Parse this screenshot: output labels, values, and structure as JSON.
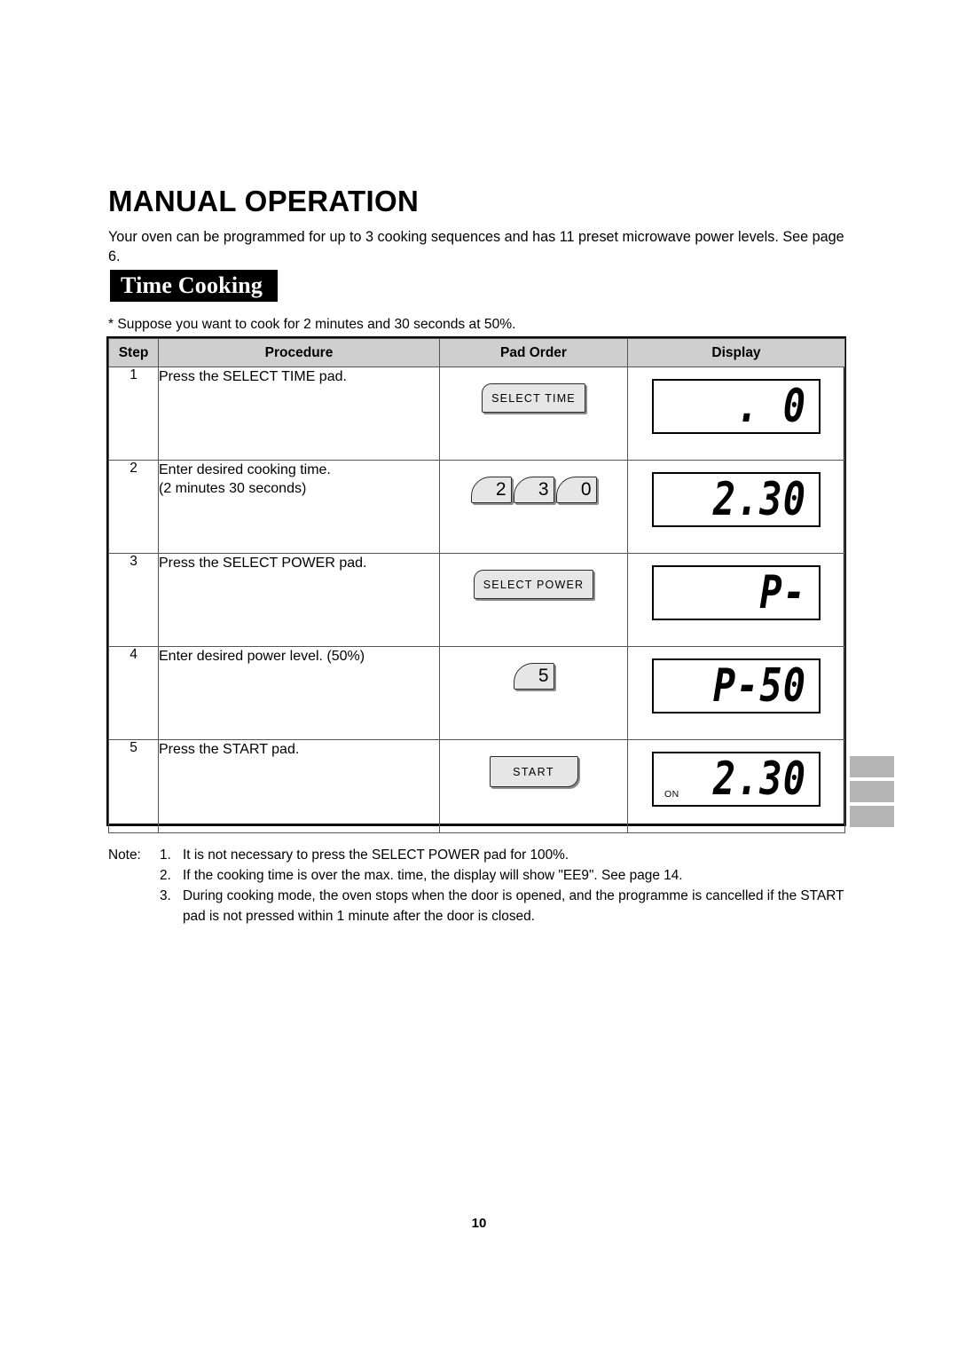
{
  "document": {
    "title": "MANUAL OPERATION",
    "intro": "Your oven can be programmed for up to 3 cooking sequences and has 11 preset microwave power levels. See page 6.",
    "section_banner": "Time Cooking",
    "example_line": "* Suppose you want to cook for 2 minutes and 30 seconds at 50%.",
    "page_number": "10"
  },
  "table": {
    "headers": {
      "step": "Step",
      "procedure": "Procedure",
      "pad_order": "Pad Order",
      "display": "Display"
    },
    "rows": [
      {
        "step": "1",
        "procedure_line1": "Press the SELECT TIME pad.",
        "procedure_line2": "",
        "pads": [
          "SELECT TIME"
        ],
        "pad_type": "text",
        "display": ". 0",
        "display_on": ""
      },
      {
        "step": "2",
        "procedure_line1": "Enter desired cooking time.",
        "procedure_line2": "(2 minutes 30 seconds)",
        "pads": [
          "2",
          "3",
          "0"
        ],
        "pad_type": "number",
        "display": "2.30",
        "display_on": ""
      },
      {
        "step": "3",
        "procedure_line1": "Press the SELECT POWER pad.",
        "procedure_line2": "",
        "pads": [
          "SELECT POWER"
        ],
        "pad_type": "text",
        "display": "P-",
        "display_on": ""
      },
      {
        "step": "4",
        "procedure_line1": "Enter desired power level. (50%)",
        "procedure_line2": "",
        "pads": [
          "5"
        ],
        "pad_type": "number",
        "display": "P-50",
        "display_on": ""
      },
      {
        "step": "5",
        "procedure_line1": "Press the START pad.",
        "procedure_line2": "",
        "pads": [
          "START"
        ],
        "pad_type": "start",
        "display": "2.30",
        "display_on": "ON"
      }
    ]
  },
  "notes": {
    "label": "Note:",
    "items": [
      {
        "number": "1.",
        "text": "It is not necessary to press the SELECT POWER pad for 100%.",
        "continuation": ""
      },
      {
        "number": "2.",
        "text": "If the cooking time is over the max. time, the display will show \"EE9\". See page 14.",
        "continuation": ""
      },
      {
        "number": "3.",
        "text": "During cooking mode, the oven stops when the door is opened, and the programme is cancelled if the START",
        "continuation": "pad is not pressed within 1 minute after the door is closed."
      }
    ]
  },
  "edge_tabs": {
    "count": 3,
    "color": "#b4b4b4"
  }
}
